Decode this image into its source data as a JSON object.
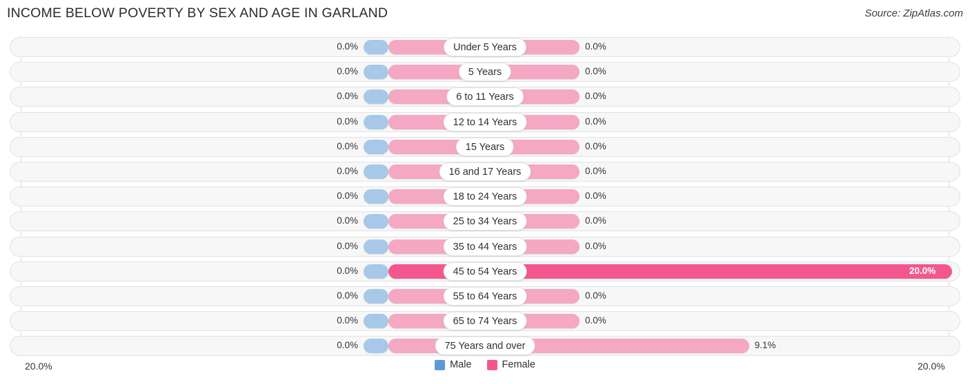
{
  "header": {
    "title": "INCOME BELOW POVERTY BY SEX AND AGE IN GARLAND",
    "source": "Source: ZipAtlas.com"
  },
  "legend": {
    "male_label": "Male",
    "female_label": "Female",
    "male_color": "#5b9bd5",
    "female_color": "#f2588f"
  },
  "axis": {
    "left_tick": "20.0%",
    "right_tick": "20.0%"
  },
  "chart_data": {
    "type": "bar",
    "title": "INCOME BELOW POVERTY BY SEX AND AGE IN GARLAND",
    "subtitle": "Source: ZipAtlas.com",
    "orientation": "horizontal-diverging",
    "xlabel": "",
    "ylabel": "",
    "xlim": [
      20.0,
      20.0
    ],
    "grid": false,
    "legend_position": "bottom-center",
    "categories": [
      "Under 5 Years",
      "5 Years",
      "6 to 11 Years",
      "12 to 14 Years",
      "15 Years",
      "16 and 17 Years",
      "18 to 24 Years",
      "25 to 34 Years",
      "35 to 44 Years",
      "45 to 54 Years",
      "55 to 64 Years",
      "65 to 74 Years",
      "75 Years and over"
    ],
    "series": [
      {
        "name": "Male",
        "color": "#a8c8e9",
        "values": [
          0.0,
          0.0,
          0.0,
          0.0,
          0.0,
          0.0,
          0.0,
          0.0,
          0.0,
          0.0,
          0.0,
          0.0,
          0.0
        ],
        "labels": [
          "0.0%",
          "0.0%",
          "0.0%",
          "0.0%",
          "0.0%",
          "0.0%",
          "0.0%",
          "0.0%",
          "0.0%",
          "0.0%",
          "0.0%",
          "0.0%",
          "0.0%"
        ]
      },
      {
        "name": "Female",
        "color": "#f5a8c3",
        "values": [
          0.0,
          0.0,
          0.0,
          0.0,
          0.0,
          0.0,
          0.0,
          0.0,
          0.0,
          20.0,
          0.0,
          0.0,
          9.1
        ],
        "labels": [
          "0.0%",
          "0.0%",
          "0.0%",
          "0.0%",
          "0.0%",
          "0.0%",
          "0.0%",
          "0.0%",
          "0.0%",
          "20.0%",
          "0.0%",
          "0.0%",
          "9.1%"
        ]
      }
    ]
  },
  "rows": [
    {
      "label": "Under 5 Years",
      "male": "0.0%",
      "female": "0.0%",
      "female_len": 0.0,
      "pill_center": 703
    },
    {
      "label": "5 Years",
      "male": "0.0%",
      "female": "0.0%",
      "female_len": 0.0,
      "pill_center": 703
    },
    {
      "label": "6 to 11 Years",
      "male": "0.0%",
      "female": "0.0%",
      "female_len": 0.0,
      "pill_center": 703
    },
    {
      "label": "12 to 14 Years",
      "male": "0.0%",
      "female": "0.0%",
      "female_len": 0.0,
      "pill_center": 703
    },
    {
      "label": "15 Years",
      "male": "0.0%",
      "female": "0.0%",
      "female_len": 0.0,
      "pill_center": 703
    },
    {
      "label": "16 and 17 Years",
      "male": "0.0%",
      "female": "0.0%",
      "female_len": 0.0,
      "pill_center": 703
    },
    {
      "label": "18 to 24 Years",
      "male": "0.0%",
      "female": "0.0%",
      "female_len": 0.0,
      "pill_center": 703
    },
    {
      "label": "25 to 34 Years",
      "male": "0.0%",
      "female": "0.0%",
      "female_len": 0.0,
      "pill_center": 703
    },
    {
      "label": "35 to 44 Years",
      "male": "0.0%",
      "female": "0.0%",
      "female_len": 0.0,
      "pill_center": 703
    },
    {
      "label": "45 to 54 Years",
      "male": "0.0%",
      "female": "20.0%",
      "female_len": 20.0,
      "pill_center": 703
    },
    {
      "label": "55 to 64 Years",
      "male": "0.0%",
      "female": "0.0%",
      "female_len": 0.0,
      "pill_center": 703
    },
    {
      "label": "65 to 74 Years",
      "male": "0.0%",
      "female": "0.0%",
      "female_len": 0.0,
      "pill_center": 703
    },
    {
      "label": "75 Years and over",
      "male": "0.0%",
      "female": "9.1%",
      "female_len": 9.1,
      "pill_center": 703
    }
  ]
}
